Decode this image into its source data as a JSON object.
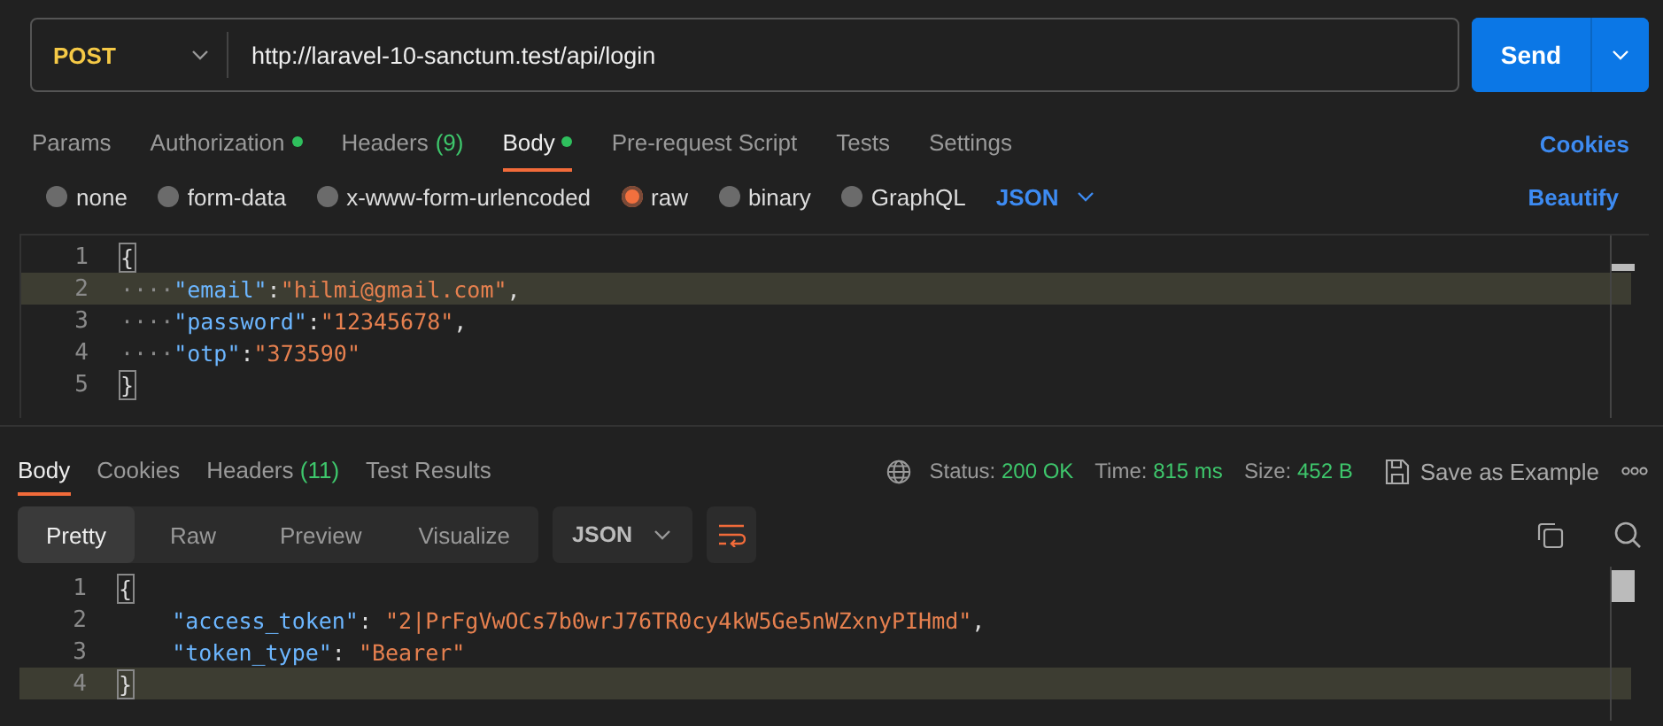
{
  "request": {
    "method": "POST",
    "url": "http://laravel-10-sanctum.test/api/login",
    "send": "Send"
  },
  "request_tabs": [
    {
      "label": "Params",
      "selected": false,
      "dot": false
    },
    {
      "label": "Authorization",
      "selected": false,
      "dot": true
    },
    {
      "label": "Headers",
      "count": "(9)",
      "selected": false,
      "dot": false
    },
    {
      "label": "Body",
      "selected": true,
      "dot": true
    },
    {
      "label": "Pre-request Script",
      "selected": false,
      "dot": false
    },
    {
      "label": "Tests",
      "selected": false,
      "dot": false
    },
    {
      "label": "Settings",
      "selected": false,
      "dot": false
    }
  ],
  "cookies_link": "Cookies",
  "body_types": [
    {
      "label": "none",
      "selected": false
    },
    {
      "label": "form-data",
      "selected": false
    },
    {
      "label": "x-www-form-urlencoded",
      "selected": false
    },
    {
      "label": "raw",
      "selected": true
    },
    {
      "label": "binary",
      "selected": false
    },
    {
      "label": "GraphQL",
      "selected": false
    }
  ],
  "raw_format": "JSON",
  "beautify": "Beautify",
  "request_body": [
    {
      "number": "1",
      "highlighted": false,
      "tokens": [
        {
          "kind": "bracket",
          "text": "{"
        }
      ]
    },
    {
      "number": "2",
      "highlighted": true,
      "tokens": [
        {
          "kind": "ws",
          "text": "····"
        },
        {
          "kind": "key",
          "text": "\"email\""
        },
        {
          "kind": "punct",
          "text": ":"
        },
        {
          "kind": "string",
          "text": "\"hilmi@gmail.com\""
        },
        {
          "kind": "punct",
          "text": ","
        }
      ]
    },
    {
      "number": "3",
      "highlighted": false,
      "tokens": [
        {
          "kind": "ws",
          "text": "····"
        },
        {
          "kind": "key",
          "text": "\"password\""
        },
        {
          "kind": "punct",
          "text": ":"
        },
        {
          "kind": "string",
          "text": "\"12345678\""
        },
        {
          "kind": "punct",
          "text": ","
        }
      ]
    },
    {
      "number": "4",
      "highlighted": false,
      "tokens": [
        {
          "kind": "ws",
          "text": "····"
        },
        {
          "kind": "key",
          "text": "\"otp\""
        },
        {
          "kind": "punct",
          "text": ":"
        },
        {
          "kind": "string",
          "text": "\"373590\""
        }
      ]
    },
    {
      "number": "5",
      "highlighted": false,
      "tokens": [
        {
          "kind": "bracket",
          "text": "}"
        }
      ]
    }
  ],
  "response_tabs": [
    {
      "label": "Body",
      "selected": true
    },
    {
      "label": "Cookies",
      "selected": false
    },
    {
      "label": "Headers",
      "count": "(11)",
      "selected": false
    },
    {
      "label": "Test Results",
      "selected": false
    }
  ],
  "response_meta": [
    {
      "label": "Status:",
      "value": "200 OK"
    },
    {
      "label": "Time:",
      "value": "815 ms"
    },
    {
      "label": "Size:",
      "value": "452 B"
    }
  ],
  "save_example": "Save as Example",
  "view_modes": [
    {
      "label": "Pretty",
      "selected": true
    },
    {
      "label": "Raw",
      "selected": false
    },
    {
      "label": "Preview",
      "selected": false
    },
    {
      "label": "Visualize",
      "selected": false
    }
  ],
  "response_format": "JSON",
  "response_body": [
    {
      "number": "1",
      "highlighted": false,
      "tokens": [
        {
          "kind": "bracket",
          "text": "{"
        }
      ]
    },
    {
      "number": "2",
      "highlighted": false,
      "tokens": [
        {
          "kind": "key",
          "text": "    \"access_token\""
        },
        {
          "kind": "punct",
          "text": ": "
        },
        {
          "kind": "string",
          "text": "\"2|PrFgVwOCs7b0wrJ76TR0cy4kW5Ge5nWZxnyPIHmd\""
        },
        {
          "kind": "punct",
          "text": ","
        }
      ]
    },
    {
      "number": "3",
      "highlighted": false,
      "tokens": [
        {
          "kind": "key",
          "text": "    \"token_type\""
        },
        {
          "kind": "punct",
          "text": ": "
        },
        {
          "kind": "string",
          "text": "\"Bearer\""
        }
      ]
    },
    {
      "number": "4",
      "highlighted": true,
      "tokens": [
        {
          "kind": "bracket",
          "text": "}"
        }
      ]
    }
  ]
}
